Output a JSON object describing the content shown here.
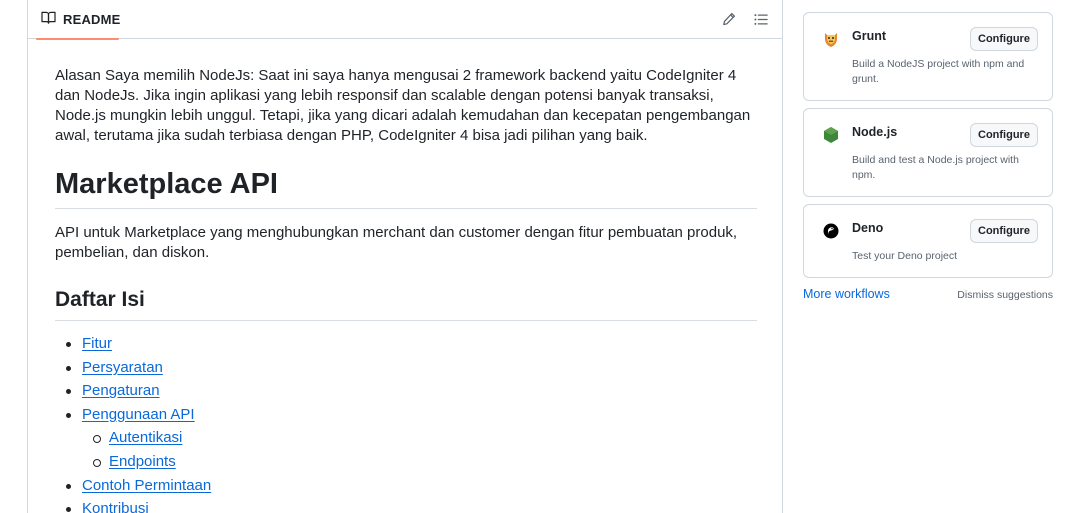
{
  "readme": {
    "tab_label": "README",
    "edit_icon": "pencil-icon",
    "outline_icon": "list-unordered-icon",
    "intro": "Alasan Saya memilih NodeJs: Saat ini saya hanya mengusai 2 framework backend yaitu CodeIgniter 4 dan NodeJs. Jika ingin aplikasi yang lebih responsif dan scalable dengan potensi banyak transaksi, Node.js mungkin lebih unggul. Tetapi, jika yang dicari adalah kemudahan dan kecepatan pengembangan awal, terutama jika sudah terbiasa dengan PHP, CodeIgniter 4 bisa jadi pilihan yang baik.",
    "title": "Marketplace API",
    "description": "API untuk Marketplace yang menghubungkan merchant dan customer dengan fitur pembuatan produk, pembelian, dan diskon.",
    "toc_heading": "Daftar Isi",
    "toc": [
      {
        "label": "Fitur",
        "level": 1
      },
      {
        "label": "Persyaratan",
        "level": 1
      },
      {
        "label": "Pengaturan",
        "level": 1
      },
      {
        "label": "Penggunaan API",
        "level": 1
      },
      {
        "label": "Autentikasi",
        "level": 2
      },
      {
        "label": "Endpoints",
        "level": 2
      },
      {
        "label": "Contoh Permintaan",
        "level": 1
      },
      {
        "label": "Kontribusi",
        "level": 1
      }
    ]
  },
  "workflows": {
    "cards": [
      {
        "title": "Grunt",
        "description": "Build a NodeJS project with npm and grunt.",
        "button": "Configure",
        "icon": "grunt-logo-icon",
        "color": "#e48632"
      },
      {
        "title": "Node.js",
        "description": "Build and test a Node.js project with npm.",
        "button": "Configure",
        "icon": "nodejs-logo-icon",
        "color": "#3c873a"
      },
      {
        "title": "Deno",
        "description": "Test your Deno project",
        "button": "Configure",
        "icon": "deno-logo-icon",
        "color": "#000000"
      }
    ],
    "more_label": "More workflows",
    "dismiss_label": "Dismiss suggestions"
  }
}
